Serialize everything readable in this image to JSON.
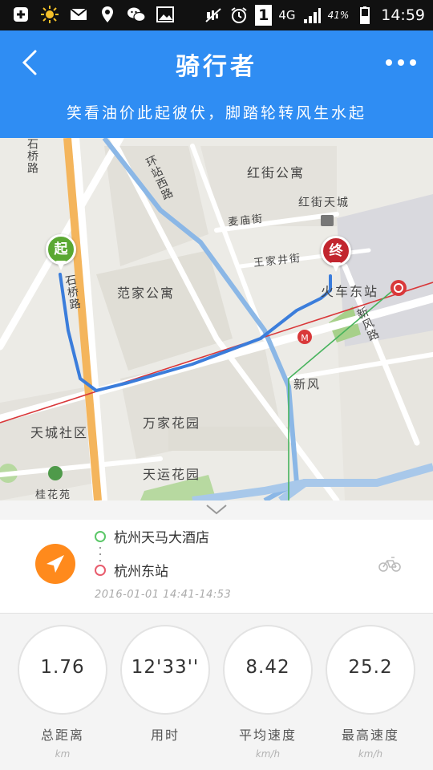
{
  "status_bar": {
    "network": "4G",
    "battery": "41%",
    "time": "14:59",
    "sim": "1",
    "icons": [
      "add-icon",
      "sun-icon",
      "mail-icon",
      "location-icon",
      "wechat-icon",
      "image-icon",
      "mute-icon",
      "alarm-icon",
      "signal-icon",
      "battery-icon"
    ]
  },
  "header": {
    "title": "骑行者",
    "slogan": "笑看油价此起彼伏，脚踏轮转风生水起",
    "background": "#2f8df3"
  },
  "map": {
    "labels": {
      "hongjie_gongyu": "红街公寓",
      "hongjie_tiancheng": "红街天城",
      "maimiao_jie": "麦庙街",
      "wangjia_jingjie": "王家井街",
      "huochedong_zhan": "火车东站",
      "fanjia_gongyu": "范家公寓",
      "xinfeng": "新风",
      "wanjia_huayuan": "万家花园",
      "tiancheng_shequ": "天城社区",
      "tianyun_huayuan": "天运花园",
      "gui_huayuan": "桂花苑",
      "shiqiao_lu": "石桥路",
      "huanzhan_xilu": "环站西路",
      "xinfeng_lu": "新风路",
      "shiqiao_road_2": "石桥路"
    },
    "start_pin": "起",
    "end_pin": "终",
    "start_color": "#5aa832",
    "end_color": "#c2262f",
    "route_color": "#3b7ddb"
  },
  "trip": {
    "from": "杭州天马大酒店",
    "to": "杭州东站",
    "time_range": "2016-01-01 14:41-14:53"
  },
  "stats": [
    {
      "value": "1.76",
      "label": "总距离",
      "unit": "km"
    },
    {
      "value": "12'33''",
      "label": "用时",
      "unit": ""
    },
    {
      "value": "8.42",
      "label": "平均速度",
      "unit": "km/h"
    },
    {
      "value": "25.2",
      "label": "最高速度",
      "unit": "km/h"
    }
  ]
}
